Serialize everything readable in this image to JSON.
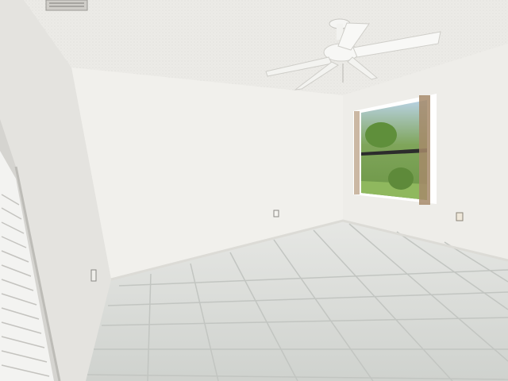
{
  "scene": {
    "description_label": "",
    "colors": {
      "ceiling": "#ecebe7",
      "back_wall": "#f1f0ec",
      "left_wall": "#e6e5e1",
      "right_wall": "#eeede9",
      "floor_tile": "#d9dbd8",
      "floor_grout": "#c3c6c3",
      "window_frame": "#ffffff",
      "window_glass_top": "#a9c7e0",
      "foliage": "#6f9a4a",
      "lawn": "#8fb85e",
      "shutter": "#f3f3f1"
    },
    "objects": [
      "ceiling-fan",
      "air-vent",
      "window",
      "louvered-closet-door",
      "electrical-outlet-back",
      "electrical-outlet-right",
      "electrical-outlet-left",
      "tile-floor"
    ]
  }
}
